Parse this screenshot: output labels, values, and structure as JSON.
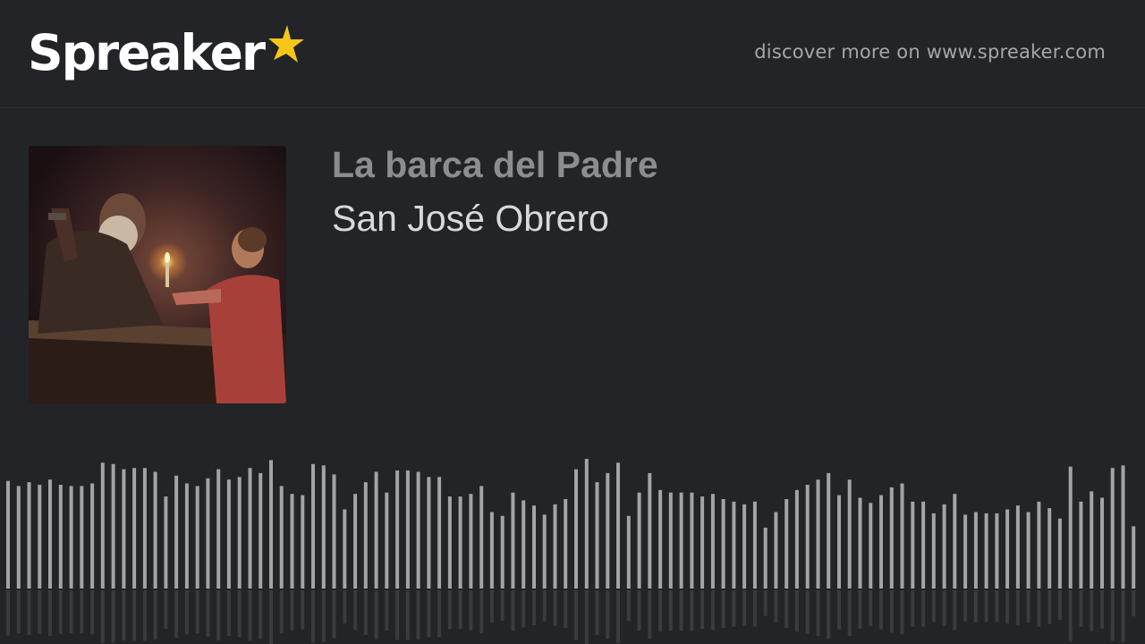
{
  "header": {
    "logo_text": "Spreaker",
    "logo_icon": "star-icon",
    "discover_text": "discover more on www.spreaker.com",
    "colors": {
      "background": "#232428",
      "star": "#f5c518",
      "logo": "#ffffff"
    }
  },
  "podcast": {
    "show_title": "La barca del Padre",
    "episode_title": "San José Obrero",
    "cover_description": "painting"
  },
  "waveform": {
    "color_upper": "#a3a4a7",
    "color_reflection": "#3a3b3f",
    "levels": [
      0.83,
      0.79,
      0.82,
      0.8,
      0.84,
      0.8,
      0.79,
      0.79,
      0.81,
      0.97,
      0.96,
      0.92,
      0.93,
      0.93,
      0.9,
      0.71,
      0.87,
      0.81,
      0.79,
      0.85,
      0.92,
      0.84,
      0.86,
      0.93,
      0.89,
      0.99,
      0.79,
      0.73,
      0.72,
      0.96,
      0.95,
      0.88,
      0.61,
      0.73,
      0.82,
      0.9,
      0.74,
      0.91,
      0.91,
      0.9,
      0.86,
      0.86,
      0.71,
      0.71,
      0.73,
      0.79,
      0.59,
      0.56,
      0.74,
      0.68,
      0.64,
      0.57,
      0.65,
      0.69,
      0.92,
      1.0,
      0.82,
      0.89,
      0.97,
      0.56,
      0.74,
      0.89,
      0.76,
      0.74,
      0.74,
      0.74,
      0.71,
      0.73,
      0.69,
      0.67,
      0.65,
      0.67,
      0.47,
      0.59,
      0.69,
      0.76,
      0.8,
      0.84,
      0.89,
      0.72,
      0.84,
      0.7,
      0.66,
      0.72,
      0.78,
      0.81,
      0.67,
      0.67,
      0.58,
      0.65,
      0.73,
      0.57,
      0.59,
      0.58,
      0.58,
      0.61,
      0.64,
      0.59,
      0.67,
      0.62,
      0.54,
      0.94,
      0.67,
      0.75,
      0.7,
      0.93,
      0.95,
      0.48
    ]
  }
}
